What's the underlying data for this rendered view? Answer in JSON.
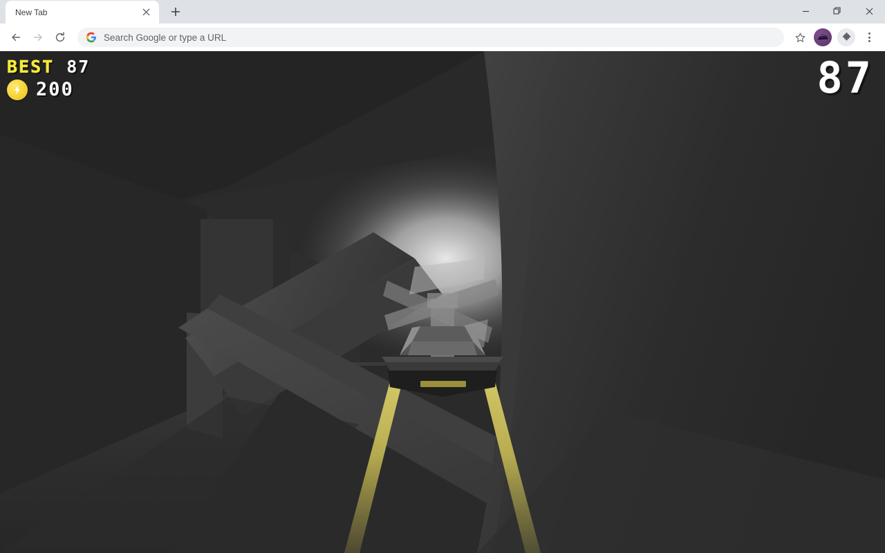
{
  "browser": {
    "tab": {
      "title": "New Tab",
      "close_label": "×",
      "close_icon": "close-icon"
    },
    "new_tab_button": {
      "label": "+",
      "icon": "plus-icon"
    },
    "window_controls": {
      "minimize": "minimize-icon",
      "maximize": "maximize-icon",
      "close": "close-icon"
    },
    "toolbar": {
      "back": "back-arrow-icon",
      "forward": "forward-arrow-icon",
      "reload": "reload-icon",
      "bookmark": "star-icon",
      "profile": "profile-avatar",
      "extensions": "puzzle-piece-icon",
      "menu": "three-dot-menu-icon"
    },
    "omnibox": {
      "placeholder": "Search Google or type a URL",
      "value": "",
      "leading_icon": "google-g-icon"
    }
  },
  "game": {
    "hud": {
      "best_label": "BEST",
      "best_score": "87",
      "coin_icon": "lightning-coin-icon",
      "coin_count": "200",
      "current_score": "87"
    },
    "colors": {
      "accent_yellow": "#f5e93b",
      "coin_gold": "#f7d63c",
      "trail_yellow": "#d4c84a",
      "background_dark": "#2b2b2b",
      "glow_white": "#e8e8e8",
      "ship_body": "#3a3a3a",
      "ship_top": "#9a9a9a"
    },
    "scene": {
      "title": "low-poly endless tunnel runner",
      "player": "hover-ship",
      "trails": 2
    }
  }
}
